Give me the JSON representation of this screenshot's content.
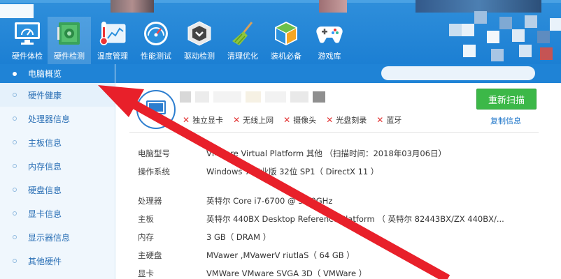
{
  "toolbar": {
    "items": [
      {
        "label": "硬件体检",
        "icon": "monitor-gauge-icon"
      },
      {
        "label": "硬件检测",
        "icon": "circuit-board-icon"
      },
      {
        "label": "温度管理",
        "icon": "thermometer-chart-icon"
      },
      {
        "label": "性能测试",
        "icon": "speedometer-icon"
      },
      {
        "label": "驱动检测",
        "icon": "driver-chip-icon"
      },
      {
        "label": "清理优化",
        "icon": "broom-icon"
      },
      {
        "label": "装机必备",
        "icon": "cube-box-icon"
      },
      {
        "label": "游戏库",
        "icon": "gamepad-icon"
      }
    ],
    "active_index": 1
  },
  "sidebar": {
    "items": [
      {
        "label": "电脑概览",
        "active": true
      },
      {
        "label": "硬件健康"
      },
      {
        "label": "处理器信息"
      },
      {
        "label": "主板信息"
      },
      {
        "label": "内存信息"
      },
      {
        "label": "硬盘信息"
      },
      {
        "label": "显卡信息"
      },
      {
        "label": "显示器信息"
      },
      {
        "label": "其他硬件"
      }
    ]
  },
  "summary": {
    "missing": [
      {
        "label": "独立显卡"
      },
      {
        "label": "无线上网"
      },
      {
        "label": "摄像头"
      },
      {
        "label": "光盘刻录"
      },
      {
        "label": "蓝牙"
      }
    ],
    "rescan_label": "重新扫描",
    "copy_label": "复制信息"
  },
  "info": {
    "rows": [
      {
        "key": "电脑型号",
        "value": "VMware Virtual Platform 其他 （扫描时间：2018年03月06日）"
      },
      {
        "key": "操作系统",
        "value": "Windows 7 专业版 32位 SP1（ DirectX 11 ）"
      },
      {
        "key": "处理器",
        "value": "英特尔 Core i7-6700 @ 3.40GHz"
      },
      {
        "key": "主板",
        "value": "英特尔 440BX Desktop Reference Platform （ 英特尔 82443BX/ZX 440BX/..."
      },
      {
        "key": "内存",
        "value": "3 GB（ DRAM ）"
      },
      {
        "key": "主硬盘",
        "value": " MVawer ,MVawerV riutlaS（ 64 GB ）"
      },
      {
        "key": "显卡",
        "value": "VMWare VMware SVGA 3D（ VMWare ）"
      }
    ]
  },
  "colors": {
    "topbar": "#1f83d6",
    "sidebar_active": "#1f83d6",
    "rescan": "#3cb848",
    "arrow": "#e8202a"
  }
}
